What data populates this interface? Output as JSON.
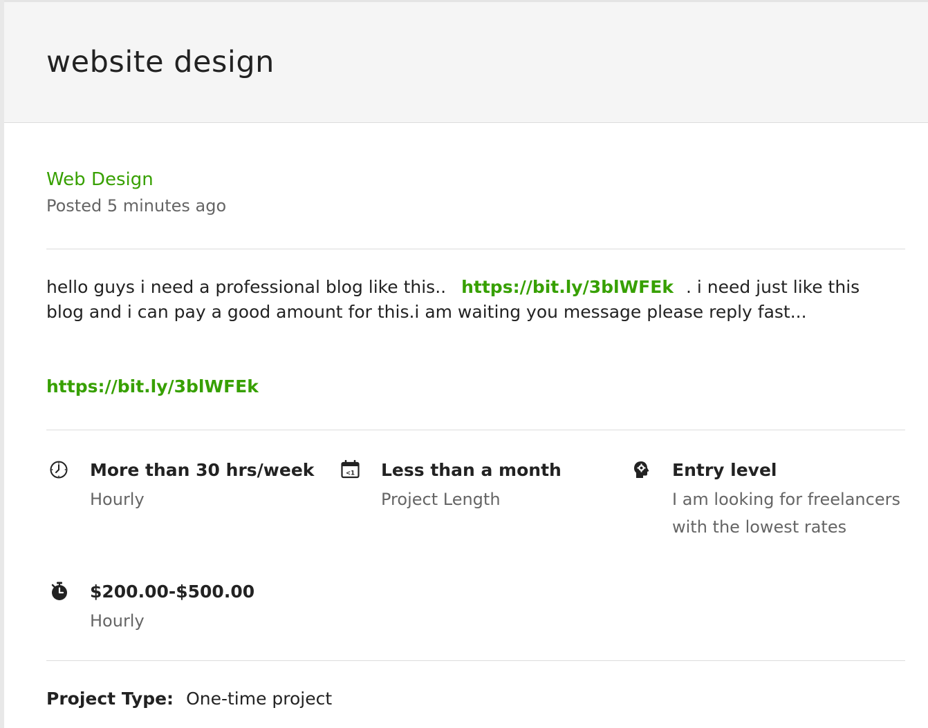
{
  "job": {
    "title": "website design",
    "category": "Web Design",
    "posted": "Posted 5 minutes ago"
  },
  "description": {
    "part1": "hello guys i need a professional blog like this..",
    "link_inline": "https://bit.ly/3blWFEk",
    "part2": ". i need just like this blog and i can pay a good amount for this.i am waiting you message please reply fast...",
    "link_standalone": "https://bit.ly/3blWFEk"
  },
  "features": {
    "hours": {
      "label": "More than 30 hrs/week",
      "sub": "Hourly",
      "icon": "clock-icon"
    },
    "length": {
      "label": "Less than a month",
      "sub": "Project Length",
      "icon": "calendar-icon"
    },
    "level": {
      "label": "Entry level",
      "sub": "I am looking for freelancers with the lowest rates",
      "icon": "head-gear-icon"
    },
    "budget": {
      "label": "$200.00-$500.00",
      "sub": "Hourly",
      "icon": "stopwatch-icon"
    }
  },
  "project_type": {
    "label": "Project Type:",
    "value": "One-time project"
  },
  "colors": {
    "accent": "#37a000",
    "muted": "#656565",
    "header_bg": "#f5f5f5"
  }
}
